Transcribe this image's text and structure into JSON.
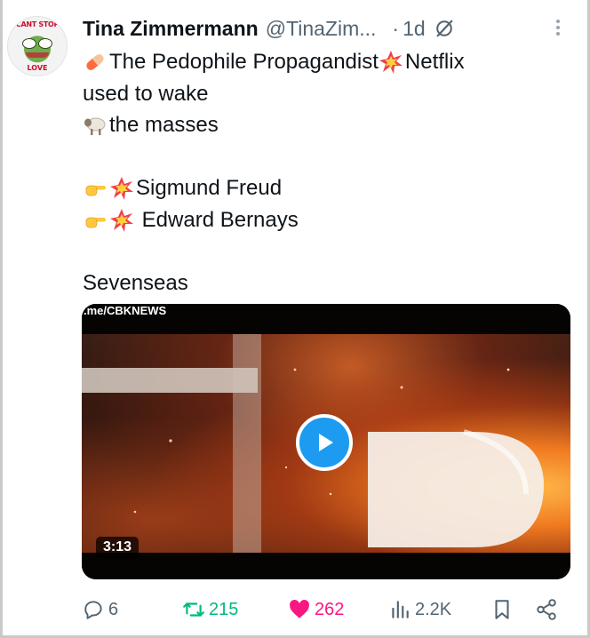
{
  "tweet": {
    "author_name": "Tina Zimmermann",
    "handle": "@TinaZim...",
    "separator": "·",
    "time": "1d",
    "avatar_top_text": "CANT STOP",
    "avatar_bottom_text": "LOVE",
    "lines": [
      {
        "emojis": [
          "pill-emoji"
        ],
        "text": "The Pedophile Propagandist "
      },
      {
        "emojis": [],
        "text": "used to wake"
      },
      {
        "emojis": [
          "sheep-emoji"
        ],
        "text": "the masses"
      },
      {
        "emojis": [],
        "text": ""
      },
      {
        "emojis": [
          "pointing-hand-emoji",
          "collision-emoji"
        ],
        "text": "Sigmund Freud"
      },
      {
        "emojis": [
          "pointing-hand-emoji",
          "collision-emoji"
        ],
        "text": " Edward Bernays"
      },
      {
        "emojis": [],
        "text": ""
      },
      {
        "emojis": [],
        "text": "Sevenseas"
      }
    ],
    "line1_tail": "Netflix",
    "media": {
      "watermark": ".me/CBKNEWS",
      "duration": "3:13"
    },
    "stats": {
      "replies": "6",
      "retweets": "215",
      "likes": "262",
      "views": "2.2K"
    },
    "colors": {
      "retweet": "#00ba7c",
      "like": "#f91880",
      "play": "#1d9bf0",
      "muted": "#536471"
    }
  }
}
